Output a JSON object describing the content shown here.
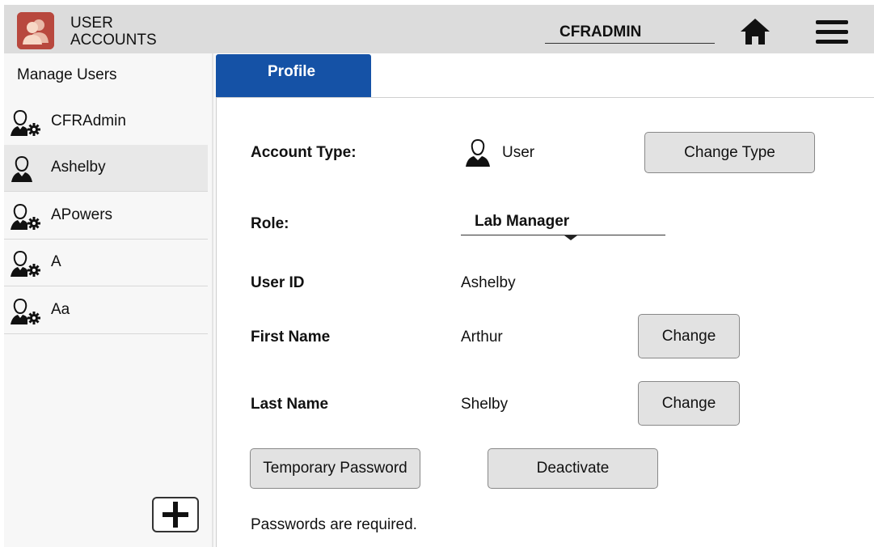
{
  "header": {
    "app_title_line1": "USER",
    "app_title_line2": "ACCOUNTS",
    "current_user": "CFRADMIN",
    "home_icon": "home-icon",
    "menu_icon": "hamburger-menu-icon"
  },
  "sidebar": {
    "title": "Manage Users",
    "users": [
      {
        "name": "CFRAdmin",
        "icon": "admin-user-icon",
        "selected": false
      },
      {
        "name": "Ashelby",
        "icon": "user-icon",
        "selected": true
      },
      {
        "name": "APowers",
        "icon": "admin-user-icon",
        "selected": false
      },
      {
        "name": "A",
        "icon": "admin-user-icon",
        "selected": false
      },
      {
        "name": "Aa",
        "icon": "admin-user-icon",
        "selected": false
      }
    ],
    "add_icon": "plus-icon"
  },
  "tabs": {
    "profile": "Profile"
  },
  "profile": {
    "account_type_label": "Account Type:",
    "account_type_value": "User",
    "change_type_button": "Change Type",
    "role_label": "Role:",
    "role_value": "Lab Manager",
    "user_id_label": "User ID",
    "user_id_value": "Ashelby",
    "first_name_label": "First Name",
    "first_name_value": "Arthur",
    "first_name_change": "Change",
    "last_name_label": "Last Name",
    "last_name_value": "Shelby",
    "last_name_change": "Change",
    "temp_password_button": "Temporary Password",
    "deactivate_button": "Deactivate",
    "note": "Passwords are required."
  },
  "colors": {
    "header_bg": "#dcdcdc",
    "app_icon_bg": "#b8483e",
    "tab_active_bg": "#1552a6",
    "button_bg": "#e2e2e2"
  }
}
